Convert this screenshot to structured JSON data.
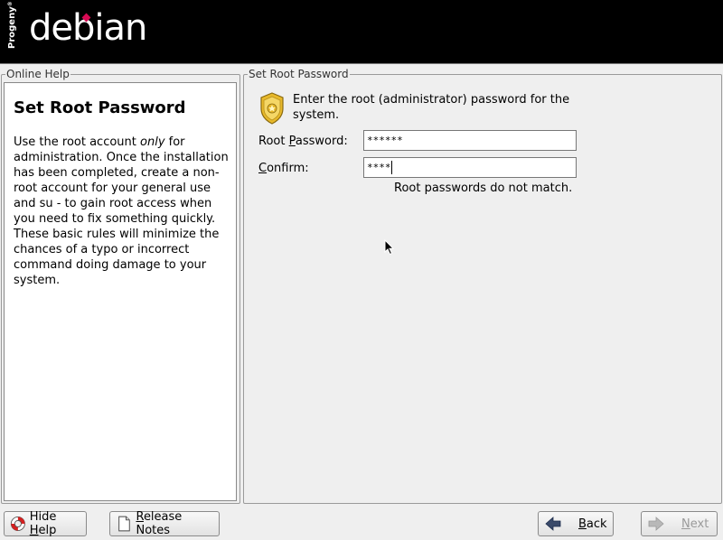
{
  "header": {
    "logo_progeny": "Progeny",
    "logo_progeny_mark": "®",
    "logo_debian": "debian"
  },
  "help": {
    "frame_title": "Online Help",
    "title": "Set Root Password",
    "body_part1": "Use the root account ",
    "body_emphasis": "only",
    "body_part2": " for administration. Once the installation has been completed, create a non-root account for your general use and su  - to gain root access when you need to fix something quickly. These basic rules will minimize the chances of a typo or incorrect command doing damage to your system."
  },
  "password": {
    "frame_title": "Set Root Password",
    "instruction": "Enter the root (administrator) password for the system.",
    "root_label_prefix": "Root ",
    "root_label_mnemonic": "P",
    "root_label_suffix": "assword:",
    "root_value": "******",
    "confirm_label_mnemonic": "C",
    "confirm_label_suffix": "onfirm:",
    "confirm_value": "****",
    "error": "Root passwords do not match."
  },
  "buttons": {
    "hide_help_prefix": "Hide ",
    "hide_help_mnemonic": "H",
    "hide_help_suffix": "elp",
    "release_notes_mnemonic": "R",
    "release_notes_suffix": "elease Notes",
    "back_mnemonic": "B",
    "back_suffix": "ack",
    "next_mnemonic": "N",
    "next_suffix": "ext"
  },
  "colors": {
    "banner": "#000000",
    "logo_dot": "#d70a53",
    "badge_gold": "#e8b92a",
    "disabled_text": "#9a9a9a"
  },
  "icons": [
    "lifebuoy-icon",
    "document-icon",
    "back-arrow-icon",
    "next-arrow-icon",
    "badge-icon",
    "mouse-pointer-icon"
  ]
}
